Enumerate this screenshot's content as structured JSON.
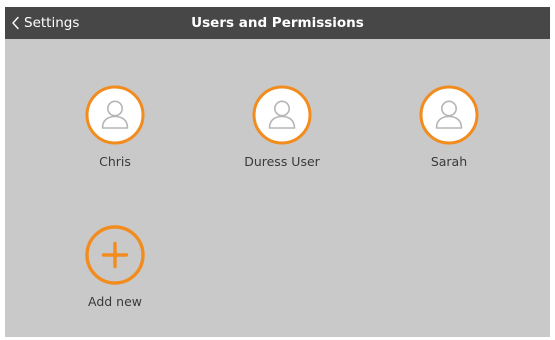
{
  "header": {
    "back_label": "Settings",
    "title": "Users and Permissions"
  },
  "users": [
    {
      "name": "Chris",
      "icon": "user-icon"
    },
    {
      "name": "Duress User",
      "icon": "user-icon"
    },
    {
      "name": "Sarah",
      "icon": "user-icon"
    }
  ],
  "add_new": {
    "label": "Add new",
    "icon": "plus-icon"
  },
  "colors": {
    "header_bg": "#474747",
    "content_bg": "#c9c9c9",
    "accent": "#f28c1e",
    "avatar_fill": "#ffffff",
    "user_glyph": "#b5b5b5"
  }
}
